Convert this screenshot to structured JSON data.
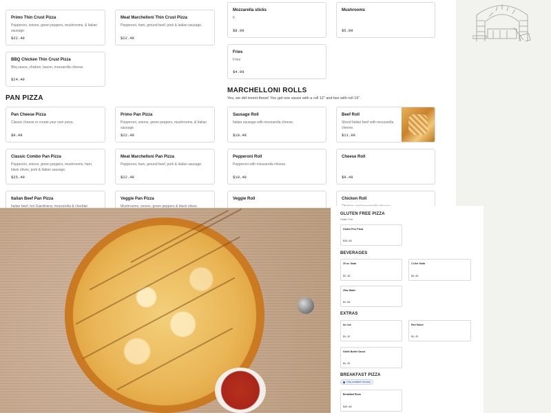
{
  "thin_crust": {
    "items": [
      {
        "name": "Primo Thin Crust Pizza",
        "desc": "Pepperoni, onions, green peppers, mushrooms, & Italian sausage.",
        "price": "$22.49"
      },
      {
        "name": "Meat Marchelloni Thin Crust Pizza",
        "desc": "Pepperoni, ham, ground beef, pork & Italian sausage.",
        "price": "$22.49"
      },
      {
        "name": "BBQ Chicken Thin Crust Pizza",
        "desc": "Bbq sauce, chicken, bacon, mozzarella cheese.",
        "price": "$24.49"
      }
    ]
  },
  "sides": {
    "items": [
      {
        "name": "Mozzarella sticks",
        "desc": "6",
        "price": "$8.99"
      },
      {
        "name": "Mushrooms",
        "desc": "",
        "price": "$5.99"
      },
      {
        "name": "Fries",
        "desc": "Fries",
        "price": "$4.99"
      }
    ]
  },
  "pan_pizza": {
    "title": "PAN PIZZA",
    "items": [
      {
        "name": "Pan Cheese Pizza",
        "desc": "Classic cheese or create your own pizza.",
        "price": "$9.49"
      },
      {
        "name": "Primo Pan Pizza",
        "desc": "Pepperoni, onions, green peppers, mushrooms, & Italian sausage.",
        "price": "$22.49"
      },
      {
        "name": "Classic Combo Pan Pizza",
        "desc": "Pepperoni, onions, green peppers, mushrooms, ham, black olives, pork & Italian sausage.",
        "price": "$25.49"
      },
      {
        "name": "Meat Marchelloni Pan Pizza",
        "desc": "Pepperoni, ham, ground beef, pork & Italian sausage.",
        "price": "$22.49"
      },
      {
        "name": "Italian Beef Pan Pizza",
        "desc": "Italian beef, hot Giardiniera, mozzarella & cheddar cheese."
      },
      {
        "name": "Veggie Pan Pizza",
        "desc": "Mushrooms, onions, green peppers & black olives."
      }
    ]
  },
  "rolls": {
    "title": "MARCHELLONI ROLLS",
    "subtitle": "Yes, we did invent these! You get one sauce with a roll 12\" and two with roll 16\".",
    "items": [
      {
        "name": "Sausage Roll",
        "desc": "Italian sausage with mozzarella cheese.",
        "price": "$10.49"
      },
      {
        "name": "Beef Roll",
        "desc": "Sliced Italian beef with mozzarella cheese.",
        "price": "$11.99"
      },
      {
        "name": "Pepperoni Roll",
        "desc": "Pepperoni with mozzarella cheese.",
        "price": "$10.49"
      },
      {
        "name": "Cheese Roll",
        "desc": "",
        "price": "$9.49"
      },
      {
        "name": "Veggie Roll",
        "desc": ""
      },
      {
        "name": "Chicken Roll",
        "desc": "Chicken and mozzarella cheese."
      }
    ]
  },
  "mini": {
    "gluten_free": {
      "title": "GLUTEN FREE PIZZA",
      "subtitle": "Gluten Free",
      "items": [
        {
          "name": "Gluten Free Pizza",
          "price": "$16.99"
        }
      ]
    },
    "beverages": {
      "title": "BEVERAGES",
      "items": [
        {
          "name": "20 oz. Soda",
          "price": "$2.49"
        },
        {
          "name": "2 Liter Soda",
          "price": "$3.49"
        },
        {
          "name": "20oz Water",
          "price": "$1.99"
        }
      ]
    },
    "extras": {
      "title": "EXTRAS",
      "items": [
        {
          "name": "Au Jus",
          "price": "$1.25"
        },
        {
          "name": "Red Sauce",
          "price": "$1.25"
        },
        {
          "name": "Garlic Butter Sauce",
          "price": "$1.25"
        }
      ]
    },
    "breakfast": {
      "title": "BREAKFAST PIZZA",
      "badge": "Only available Sunday",
      "items": [
        {
          "name": "Breakfast Pizza",
          "price": "$20.99"
        }
      ]
    }
  },
  "colors": {
    "side_panel": "#f2f2ef",
    "border": "#d9d9d9",
    "badge": "#2b4f9a"
  }
}
